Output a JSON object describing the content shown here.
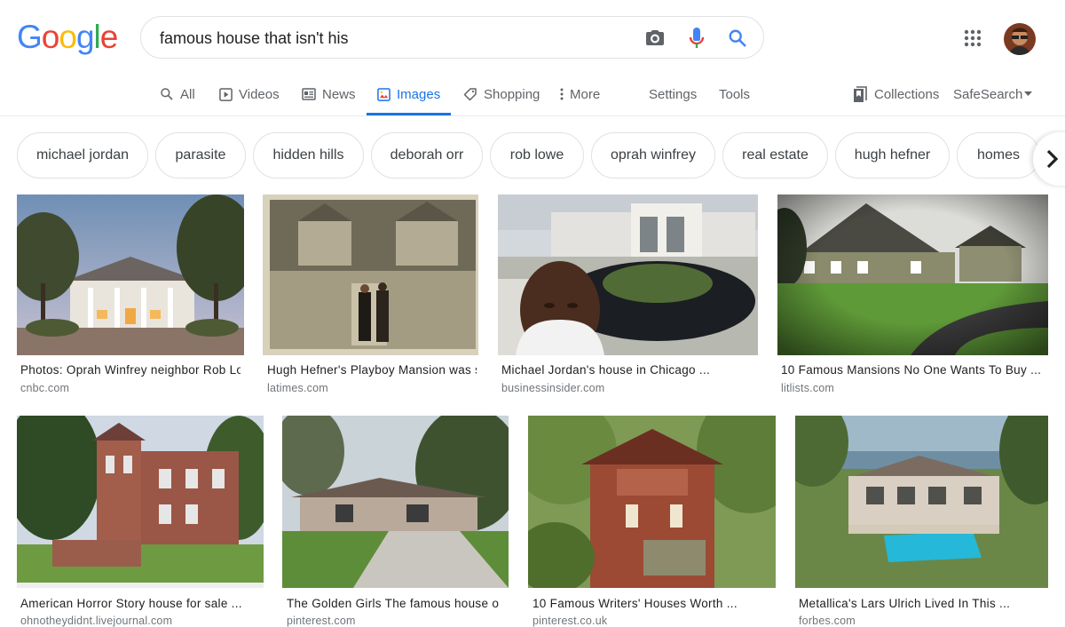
{
  "logo": {
    "letters": [
      "G",
      "o",
      "o",
      "g",
      "l",
      "e"
    ],
    "colors": [
      "#4285F4",
      "#EA4335",
      "#FBBC05",
      "#4285F4",
      "#34A853",
      "#EA4335"
    ]
  },
  "search": {
    "query": "famous house that isn't his"
  },
  "icons": {
    "camera": "camera-icon",
    "mic": "mic-icon",
    "search": "search-icon",
    "apps": "apps-grid-icon",
    "collections": "bookmark-icon"
  },
  "tabs": [
    {
      "label": "All"
    },
    {
      "label": "Videos"
    },
    {
      "label": "News"
    },
    {
      "label": "Images"
    },
    {
      "label": "Shopping"
    },
    {
      "label": "More"
    }
  ],
  "tools": {
    "settings": "Settings",
    "tools": "Tools"
  },
  "right": {
    "collections": "Collections",
    "safesearch": "SafeSearch"
  },
  "chips": [
    "michael jordan",
    "parasite",
    "hidden hills",
    "deborah orr",
    "rob lowe",
    "oprah winfrey",
    "real estate",
    "hugh hefner",
    "homes"
  ],
  "results": [
    {
      "caption": "Photos: Oprah Winfrey neighbor Rob Lowe ...",
      "source": "cnbc.com"
    },
    {
      "caption": "Hugh Hefner's Playboy Mansion was sold ...",
      "source": "latimes.com"
    },
    {
      "caption": "Michael Jordan's house in Chicago ...",
      "source": "businessinsider.com"
    },
    {
      "caption": "10 Famous Mansions No One Wants To Buy ...",
      "source": "litlists.com"
    },
    {
      "caption": "American Horror Story house for sale ...",
      "source": "ohnotheydidnt.livejournal.com"
    },
    {
      "caption": "The Golden Girls The famous house on ...",
      "source": "pinterest.com"
    },
    {
      "caption": "10 Famous Writers' Houses Worth ...",
      "source": "pinterest.co.uk"
    },
    {
      "caption": "Metallica's Lars Ulrich Lived In This ...",
      "source": "forbes.com"
    }
  ],
  "colors": {
    "accent": "#1a73e8",
    "border": "#dfe1e5",
    "muted": "#5f6368"
  }
}
